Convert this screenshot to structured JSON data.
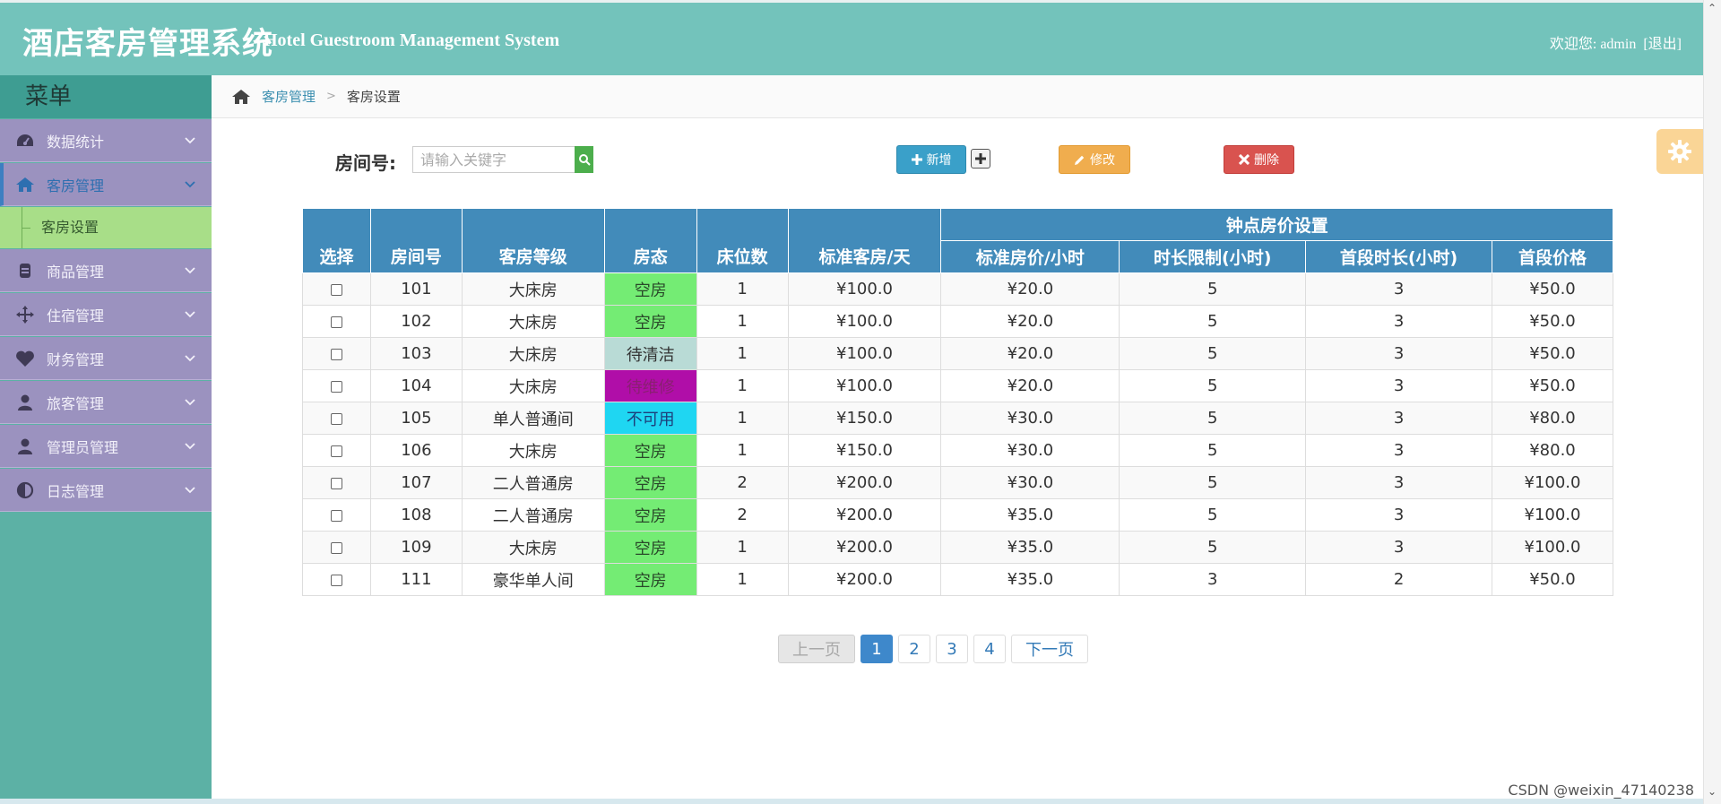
{
  "header": {
    "title_cn": "酒店客房管理系统",
    "title_en": "Hotel Guestroom Management System",
    "welcome": "欢迎您:",
    "username": "admin",
    "logout": "[退出]"
  },
  "sidebar": {
    "title": "菜单",
    "items": [
      {
        "label": "数据统计",
        "icon": "dashboard-icon"
      },
      {
        "label": "客房管理",
        "icon": "home-icon",
        "active": true
      },
      {
        "label": "商品管理",
        "icon": "product-icon"
      },
      {
        "label": "住宿管理",
        "icon": "move-icon"
      },
      {
        "label": "财务管理",
        "icon": "heart-icon"
      },
      {
        "label": "旅客管理",
        "icon": "user-icon"
      },
      {
        "label": "管理员管理",
        "icon": "user-icon"
      },
      {
        "label": "日志管理",
        "icon": "contrast-icon"
      }
    ],
    "submenu": [
      "客房设置"
    ]
  },
  "breadcrumb": {
    "parent": "客房管理",
    "current": "客房设置"
  },
  "toolbar": {
    "search_label": "房间号:",
    "search_placeholder": "请输入关键字",
    "add_label": "新增",
    "edit_label": "修改",
    "delete_label": "删除"
  },
  "table": {
    "group_header": "钟点房价设置",
    "columns": [
      "选择",
      "房间号",
      "客房等级",
      "房态",
      "床位数",
      "标准客房/天",
      "标准房价/小时",
      "时长限制(小时)",
      "首段时长(小时)",
      "首段价格"
    ],
    "rows": [
      {
        "room": "101",
        "level": "大床房",
        "status": "空房",
        "status_type": "available",
        "beds": "1",
        "daily": "¥100.0",
        "hourly": "¥20.0",
        "limit": "5",
        "first": "3",
        "first_price": "¥50.0"
      },
      {
        "room": "102",
        "level": "大床房",
        "status": "空房",
        "status_type": "available",
        "beds": "1",
        "daily": "¥100.0",
        "hourly": "¥20.0",
        "limit": "5",
        "first": "3",
        "first_price": "¥50.0"
      },
      {
        "room": "103",
        "level": "大床房",
        "status": "待清洁",
        "status_type": "cleaning",
        "beds": "1",
        "daily": "¥100.0",
        "hourly": "¥20.0",
        "limit": "5",
        "first": "3",
        "first_price": "¥50.0"
      },
      {
        "room": "104",
        "level": "大床房",
        "status": "待维修",
        "status_type": "repair",
        "beds": "1",
        "daily": "¥100.0",
        "hourly": "¥20.0",
        "limit": "5",
        "first": "3",
        "first_price": "¥50.0"
      },
      {
        "room": "105",
        "level": "单人普通间",
        "status": "不可用",
        "status_type": "unavail",
        "beds": "1",
        "daily": "¥150.0",
        "hourly": "¥30.0",
        "limit": "5",
        "first": "3",
        "first_price": "¥80.0"
      },
      {
        "room": "106",
        "level": "大床房",
        "status": "空房",
        "status_type": "available",
        "beds": "1",
        "daily": "¥150.0",
        "hourly": "¥30.0",
        "limit": "5",
        "first": "3",
        "first_price": "¥80.0"
      },
      {
        "room": "107",
        "level": "二人普通房",
        "status": "空房",
        "status_type": "available",
        "beds": "2",
        "daily": "¥200.0",
        "hourly": "¥30.0",
        "limit": "5",
        "first": "3",
        "first_price": "¥100.0"
      },
      {
        "room": "108",
        "level": "二人普通房",
        "status": "空房",
        "status_type": "available",
        "beds": "2",
        "daily": "¥200.0",
        "hourly": "¥35.0",
        "limit": "5",
        "first": "3",
        "first_price": "¥100.0"
      },
      {
        "room": "109",
        "level": "大床房",
        "status": "空房",
        "status_type": "available",
        "beds": "1",
        "daily": "¥200.0",
        "hourly": "¥35.0",
        "limit": "5",
        "first": "3",
        "first_price": "¥100.0"
      },
      {
        "room": "111",
        "level": "豪华单人间",
        "status": "空房",
        "status_type": "available",
        "beds": "1",
        "daily": "¥200.0",
        "hourly": "¥35.0",
        "limit": "3",
        "first": "2",
        "first_price": "¥50.0"
      }
    ]
  },
  "pagination": {
    "prev": "上一页",
    "pages": [
      "1",
      "2",
      "3",
      "4"
    ],
    "current": "1",
    "next": "下一页"
  },
  "watermark": "CSDN @weixin_47140238",
  "colors": {
    "header_bg": "#73c3bb",
    "sidebar_bg": "#5cb1a5",
    "menu_item_bg": "#9b92bf",
    "submenu_bg": "#a8de88",
    "table_header_bg": "#428bba",
    "status_available": "#74ec74",
    "status_cleaning": "#b9dbd6",
    "status_repair": "#b00ea8",
    "status_unavailable": "#1fd6f2",
    "add_button": "#3aa0c9",
    "edit_button": "#f0ad4e",
    "delete_button": "#d9534f"
  }
}
